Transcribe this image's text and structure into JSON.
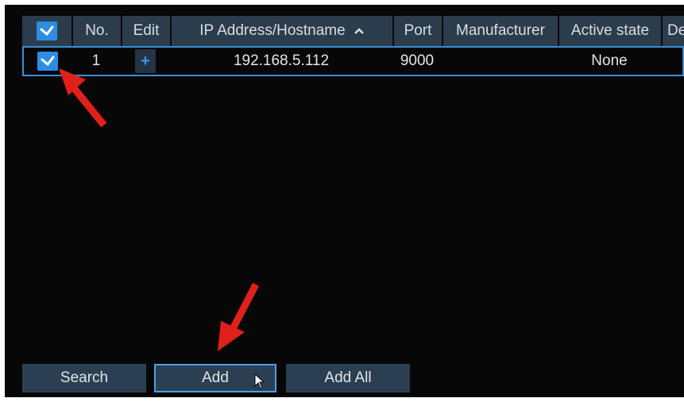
{
  "table": {
    "columns": [
      "No.",
      "Edit",
      "IP Address/Hostname",
      "Port",
      "Manufacturer",
      "Active state",
      "De"
    ],
    "rows": [
      {
        "no": "1",
        "edit": "+",
        "ip": "192.168.5.112",
        "port": "9000",
        "manufacturer": "",
        "active_state": "None",
        "device": ""
      }
    ]
  },
  "buttons": {
    "search": "Search",
    "add": "Add",
    "add_all": "Add All"
  },
  "colors": {
    "accent": "#2e8de2",
    "header_bg": "#2b3c4c",
    "button_bg": "#2c3f52",
    "annotation_arrow": "#e0201b"
  },
  "icons": [
    "checkmark-icon",
    "chevron-up-icon",
    "plus-icon",
    "mouse-pointer-icon",
    "red-arrow-icon"
  ]
}
